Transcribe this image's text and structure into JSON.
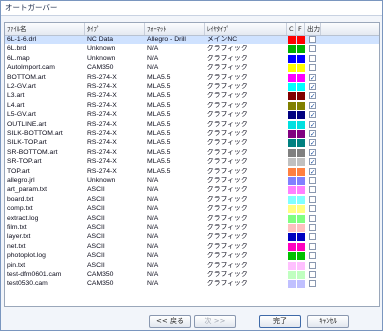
{
  "window": {
    "title": "オートガーバー"
  },
  "table": {
    "columns": [
      "ﾌｧｲﾙ名",
      "ﾀｲﾌﾟ",
      "ﾌｫｰﾏｯﾄ",
      "ﾚｲﾔﾀｲﾌﾟ",
      "C",
      "F",
      "出力"
    ],
    "rows": [
      {
        "file": "6L-1-6.drl",
        "type": "NC Data",
        "format": "Allegro - Drill",
        "layer": "メインNC",
        "c": "#ff0000",
        "f": "#ff0000",
        "out": false
      },
      {
        "file": "6L.brd",
        "type": "Unknown",
        "format": "N/A",
        "layer": "グラフィック",
        "c": "#00b000",
        "f": "#00b000",
        "out": false
      },
      {
        "file": "6L.map",
        "type": "Unknown",
        "format": "N/A",
        "layer": "グラフィック",
        "c": "#0000ff",
        "f": "#0000ff",
        "out": false
      },
      {
        "file": "AutoImport.cam",
        "type": "CAM350",
        "format": "N/A",
        "layer": "グラフィック",
        "c": "#ffff00",
        "f": "#ffff00",
        "out": false
      },
      {
        "file": "BOTTOM.art",
        "type": "RS-274-X",
        "format": "MLA5.5",
        "layer": "グラフィック",
        "c": "#ff00ff",
        "f": "#ff00ff",
        "out": true
      },
      {
        "file": "L2-GV.art",
        "type": "RS-274-X",
        "format": "MLA5.5",
        "layer": "グラフィック",
        "c": "#00ffff",
        "f": "#00ffff",
        "out": true
      },
      {
        "file": "L3.art",
        "type": "RS-274-X",
        "format": "MLA5.5",
        "layer": "グラフィック",
        "c": "#800000",
        "f": "#800000",
        "out": true
      },
      {
        "file": "L4.art",
        "type": "RS-274-X",
        "format": "MLA5.5",
        "layer": "グラフィック",
        "c": "#808000",
        "f": "#808000",
        "out": true
      },
      {
        "file": "L5-GV.art",
        "type": "RS-274-X",
        "format": "MLA5.5",
        "layer": "グラフィック",
        "c": "#000080",
        "f": "#000080",
        "out": true
      },
      {
        "file": "OUTLINE.art",
        "type": "RS-274-X",
        "format": "MLA5.5",
        "layer": "グラフィック",
        "c": "#00e0e0",
        "f": "#00e0e0",
        "out": true
      },
      {
        "file": "SILK-BOTTOM.art",
        "type": "RS-274-X",
        "format": "MLA5.5",
        "layer": "グラフィック",
        "c": "#800080",
        "f": "#800080",
        "out": true
      },
      {
        "file": "SILK-TOP.art",
        "type": "RS-274-X",
        "format": "MLA5.5",
        "layer": "グラフィック",
        "c": "#008080",
        "f": "#008080",
        "out": true
      },
      {
        "file": "SR-BOTTOM.art",
        "type": "RS-274-X",
        "format": "MLA5.5",
        "layer": "グラフィック",
        "c": "#808080",
        "f": "#808080",
        "out": true
      },
      {
        "file": "SR-TOP.art",
        "type": "RS-274-X",
        "format": "MLA5.5",
        "layer": "グラフィック",
        "c": "#c0c0c0",
        "f": "#c0c0c0",
        "out": true
      },
      {
        "file": "TOP.art",
        "type": "RS-274-X",
        "format": "MLA5.5",
        "layer": "グラフィック",
        "c": "#ff8040",
        "f": "#ff8040",
        "out": true
      },
      {
        "file": "allegro.jrl",
        "type": "Unknown",
        "format": "N/A",
        "layer": "グラフィック",
        "c": "#8080ff",
        "f": "#8080ff",
        "out": false
      },
      {
        "file": "art_param.txt",
        "type": "ASCII",
        "format": "N/A",
        "layer": "グラフィック",
        "c": "#ff80ff",
        "f": "#ff80ff",
        "out": false
      },
      {
        "file": "board.txt",
        "type": "ASCII",
        "format": "N/A",
        "layer": "グラフィック",
        "c": "#80ffff",
        "f": "#80ffff",
        "out": false
      },
      {
        "file": "comp.txt",
        "type": "ASCII",
        "format": "N/A",
        "layer": "グラフィック",
        "c": "#ffff80",
        "f": "#ffff80",
        "out": false
      },
      {
        "file": "extract.log",
        "type": "ASCII",
        "format": "N/A",
        "layer": "グラフィック",
        "c": "#80ff80",
        "f": "#80ff80",
        "out": false
      },
      {
        "file": "film.txt",
        "type": "ASCII",
        "format": "N/A",
        "layer": "グラフィック",
        "c": "#ffc0c0",
        "f": "#ffc0c0",
        "out": false
      },
      {
        "file": "layer.txt",
        "type": "ASCII",
        "format": "N/A",
        "layer": "グラフィック",
        "c": "#0000c0",
        "f": "#0000c0",
        "out": false
      },
      {
        "file": "net.txt",
        "type": "ASCII",
        "format": "N/A",
        "layer": "グラフィック",
        "c": "#ff00c0",
        "f": "#ff00c0",
        "out": false
      },
      {
        "file": "photoplot.log",
        "type": "ASCII",
        "format": "N/A",
        "layer": "グラフィック",
        "c": "#00c000",
        "f": "#00c000",
        "out": false
      },
      {
        "file": "pin.txt",
        "type": "ASCII",
        "format": "N/A",
        "layer": "グラフィック",
        "c": "#ffc0ff",
        "f": "#ffc0ff",
        "out": false
      },
      {
        "file": "test-dfm0601.cam",
        "type": "CAM350",
        "format": "N/A",
        "layer": "グラフィック",
        "c": "#c0ffc0",
        "f": "#c0ffc0",
        "out": false
      },
      {
        "file": "test0530.cam",
        "type": "CAM350",
        "format": "N/A",
        "layer": "グラフィック",
        "c": "#c0c0ff",
        "f": "#c0c0ff",
        "out": false
      }
    ]
  },
  "buttons": {
    "back": "<< 戻る",
    "next": "次 >>",
    "finish": "完了",
    "cancel": "ｷｬﾝｾﾙ"
  }
}
